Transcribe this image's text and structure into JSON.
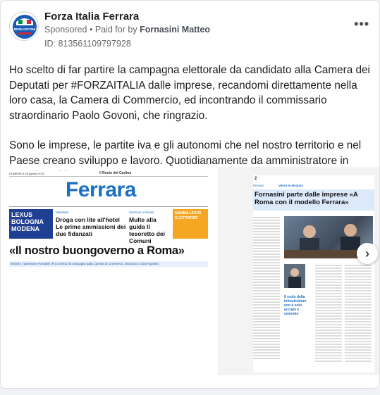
{
  "ad": {
    "page_name": "Forza Italia Ferrara",
    "sponsored_label": "Sponsored",
    "paid_for_label": "Paid for by",
    "payer": "Fornasini Matteo",
    "ad_id": "ID: 813561109797928",
    "more_label": "•••",
    "logo_text": "BERLUSCONI"
  },
  "body": {
    "paragraph1": "Ho scelto di far partire la campagna elettorale da candidato alla Camera dei Deputati per #FORZAITALIA dalle imprese, recandomi direttamente nella loro casa, la Camera di Commercio, ed incontrando il commissario straordinario Paolo Govoni, che ringrazio.",
    "paragraph2": "Sono le imprese, le partite iva e gli autonomi che nel nostro territorio e nel Paese creano sviluppo e lavoro. Quotidianamente da amministratore in questi anni ho…"
  },
  "slide1": {
    "date": "DOMENICA 28 agosto 2022",
    "paper": "il Resto del Carlino",
    "masthead": "Ferrara",
    "box1_title": "LEXUS BOLOGNA MODENA",
    "story1_kicker": "Maxidete",
    "story1_title": "Droga con lite all'hotel Le prime ammissioni dei due fidanzati",
    "story2_kicker": "Sanzioni a tiriuavi",
    "story2_title": "Multe alla guida Il tesoretto dei Comuni",
    "box2_title": "GAMMA LEXUS ELECTRIFIED",
    "headline": "«Il nostro buongoverno a Roma»",
    "caption": "Elezioni, l'assessore Fornasini (FI) comincia la campagna dalla Camera di Commercio. Bonaccini a Sant'Agostino"
  },
  "slide2": {
    "page_num": "2",
    "section": "Verso le elezioni",
    "city": "Ferrara",
    "headline": "Fornasini parte dalle imprese «A Roma con il modello Ferrara»",
    "quote": "Il ruolo della infrastrutture non è solo acciaio e cemento"
  },
  "carousel": {
    "next_icon_label": "›"
  }
}
